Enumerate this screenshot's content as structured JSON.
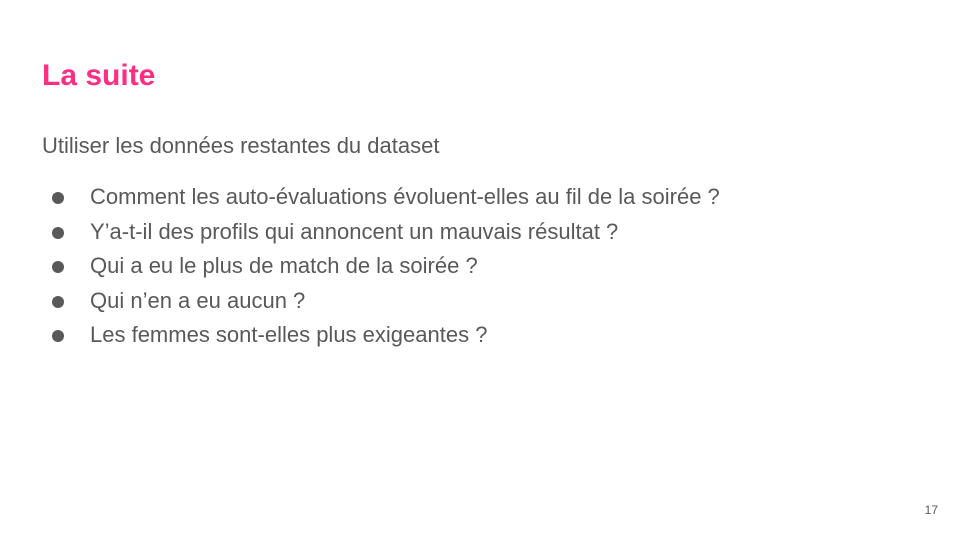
{
  "slide": {
    "title": "La suite",
    "title_color": "#ff2e84",
    "intro": "Utiliser les données restantes du dataset",
    "bullets": [
      "Comment les auto-évaluations évoluent-elles au fil de la soirée ?",
      "Y’a-t-il des profils qui annoncent un mauvais résultat ?",
      "Qui a eu le plus de match de la soirée ?",
      "Qui n’en a eu aucun ?",
      "Les femmes sont-elles plus exigeantes ?"
    ],
    "bullet_icon": "bullet-dot-icon",
    "page_number": "17"
  }
}
